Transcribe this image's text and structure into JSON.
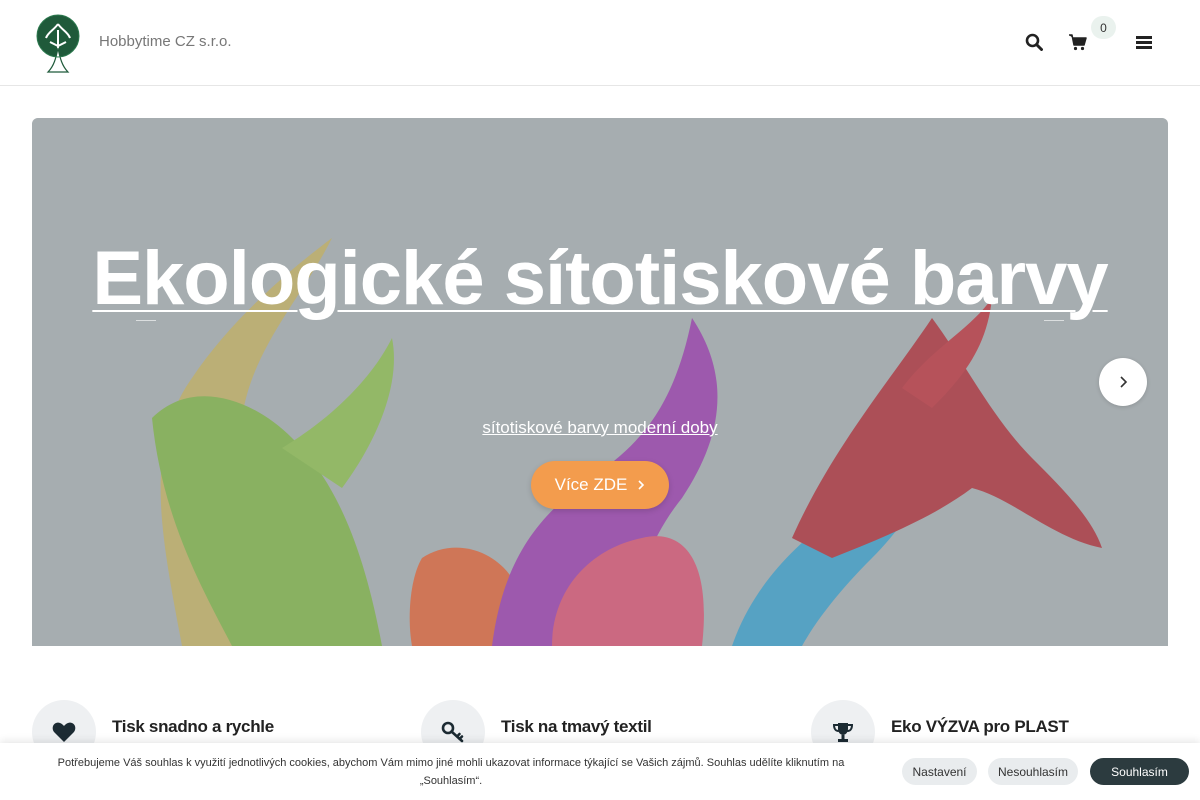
{
  "header": {
    "brand": "Hobbytime CZ s.r.o.",
    "logo_icon": "tree-logo",
    "cart_count": "0",
    "icons": [
      "search-icon",
      "cart-icon",
      "hamburger-menu-icon"
    ]
  },
  "hero": {
    "title": "Ekologické sítotiskové barvy",
    "subtitle": "sítotiskové barvy moderní doby",
    "cta_label": "Více ZDE",
    "accent_color": "#f39c4d"
  },
  "features": [
    {
      "title": "Tisk snadno a rychle",
      "icon": "heart-icon"
    },
    {
      "title": "Tisk na tmavý textil",
      "icon": "key-icon"
    },
    {
      "title": "Eko VÝZVA pro PLAST",
      "icon": "trophy-icon"
    }
  ],
  "cookie_bar": {
    "text": "Potřebujeme Váš souhlas k využití jednotlivých cookies, abychom Vám mimo jiné mohli ukazovat informace týkající se Vašich zájmů. Souhlas udělíte kliknutím na „Souhlasím“.",
    "settings_label": "Nastavení",
    "refuse_label": "Nesouhlasím",
    "accept_label": "Souhlasím",
    "accept_color": "#2c3b3f"
  }
}
